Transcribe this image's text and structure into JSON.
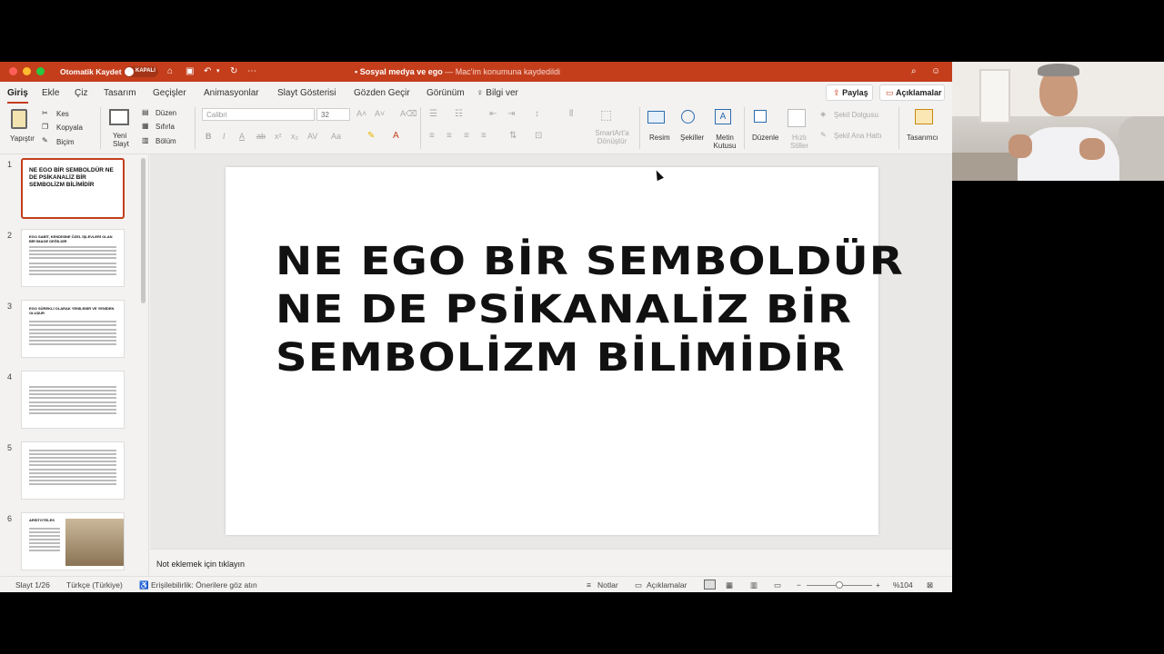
{
  "titlebar": {
    "autosave_label": "Otomatik Kaydet",
    "autosave_state": "KAPALI",
    "doc_name": "Sosyal medya ve ego",
    "doc_status": "— Mac'im konumuna kaydedildi"
  },
  "tabs": [
    "Giriş",
    "Ekle",
    "Çiz",
    "Tasarım",
    "Geçişler",
    "Animasyonlar",
    "Slayt Gösterisi",
    "Gözden Geçir",
    "Görünüm",
    "Bilgi ver"
  ],
  "share_label": "Paylaş",
  "comments_label": "Açıklamalar",
  "ribbon": {
    "paste": "Yapıştır",
    "cut": "Kes",
    "copy": "Kopyala",
    "format": "Biçim",
    "new_slide": "Yeni Slayt",
    "layout": "Düzen",
    "reset": "Sıfırla",
    "section": "Bölüm",
    "font_name": "Calibri",
    "font_size": "32",
    "smartart": "SmartArt'a Dönüştür",
    "picture": "Resim",
    "shapes": "Şekiller",
    "textbox": "Metin Kutusu",
    "arrange": "Düzenle",
    "quick_styles": "Hızlı Stiller",
    "shape_fill": "Şekil Dolgusu",
    "shape_outline": "Şekil Ana Hattı",
    "designer": "Tasarımcı"
  },
  "thumbnails": [
    {
      "num": "1",
      "title": "NE EGO BİR SEMBOLDÜR NE DE PSİKANALİZ BİR SEMBOLİZM BİLİMİDİR"
    },
    {
      "num": "2",
      "title": "EGO SABİT, KENDİSİNE ÖZEL İŞLEVLERİ OLAN BİR İMAGE DEĞİLDİR"
    },
    {
      "num": "3",
      "title": "EGO SÜREKLİ OLARAK YENİLENİR VE YENİDEN OLUŞUR"
    },
    {
      "num": "4",
      "title": ""
    },
    {
      "num": "5",
      "title": ""
    },
    {
      "num": "6",
      "title": "ARİSTOTELES"
    }
  ],
  "slide": {
    "title": "NE EGO BİR SEMBOLDÜR NE DE PSİKANALİZ BİR SEMBOLİZM BİLİMİDİR"
  },
  "notes_placeholder": "Not eklemek için tıklayın",
  "status": {
    "slide_counter": "Slayt 1/26",
    "language": "Türkçe (Türkiye)",
    "accessibility": "Erişilebilirlik: Önerilere göz atın",
    "notes": "Notlar",
    "comments": "Açıklamalar",
    "zoom": "%104"
  },
  "colors": {
    "accent": "#c43e1c"
  }
}
